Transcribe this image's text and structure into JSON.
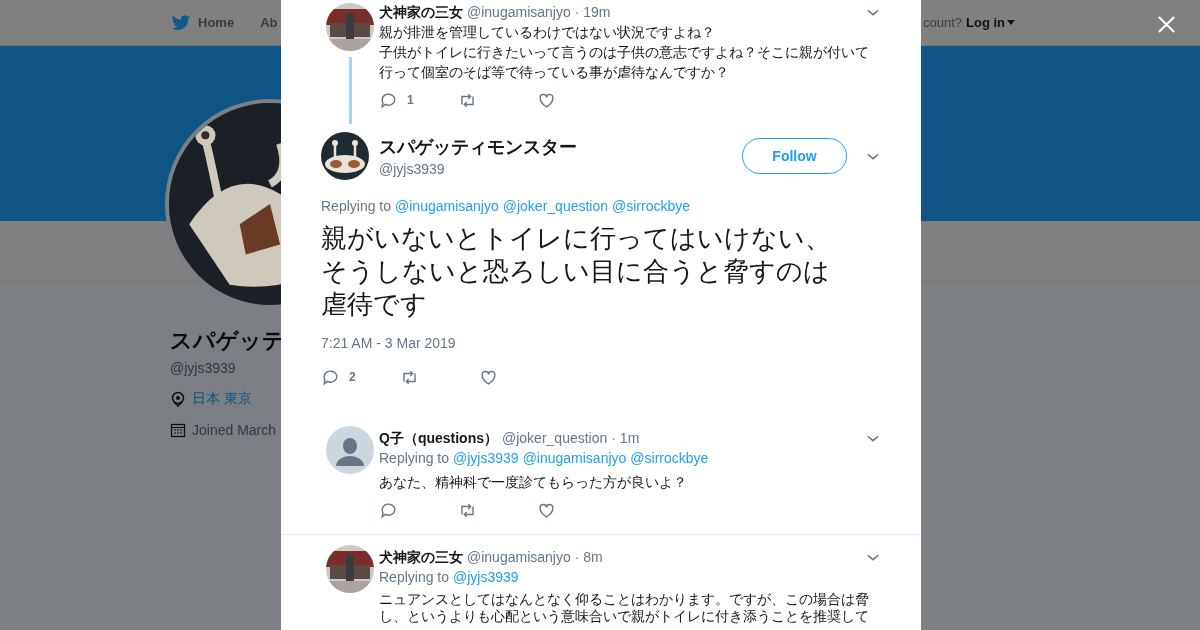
{
  "nav": {
    "items": [
      {
        "label": "Home"
      },
      {
        "label": "Ab"
      }
    ],
    "account_prompt": "count?",
    "login": "Log in"
  },
  "profile": {
    "name": "スパゲッテ",
    "handle": "@jyjs3939",
    "location": "日本 東京",
    "joined": "Joined March"
  },
  "parent_tweet": {
    "author": "犬神家の三女",
    "handle": "@inugamisanjyo",
    "time": "· 19m",
    "lines": [
      "親が排泄を管理しているわけではない状況ですよね？",
      "子供がトイレに行きたいって言うのは子供の意志ですよね？そこに親が付いて",
      "行って個室のそば等で待っている事が虐待なんですか？"
    ],
    "reply_count": "1"
  },
  "main_tweet": {
    "author": "スパゲッティモンスター",
    "handle": "@jyjs3939",
    "follow": "Follow",
    "replying_label": "Replying to",
    "replying_to": [
      "@inugamisanjyo",
      "@joker_question",
      "@sirrockbye"
    ],
    "lines": [
      "親がいないとトイレに行ってはいけない、",
      "そうしないと恐ろしい目に合うと脅すのは",
      "虐待です"
    ],
    "timestamp": "7:21 AM - 3 Mar 2019",
    "reply_count": "2"
  },
  "replies": [
    {
      "author": "Q子（questions）",
      "handle": "@joker_question",
      "time": "· 1m",
      "replying_label": "Replying to",
      "replying_to": [
        "@jyjs3939",
        "@inugamisanjyo",
        "@sirrockbye"
      ],
      "lines": [
        "あなた、精神科で一度診てもらった方が良いよ？"
      ]
    },
    {
      "author": "犬神家の三女",
      "handle": "@inugamisanjyo",
      "time": "· 8m",
      "replying_label": "Replying to",
      "replying_to": [
        "@jyjs3939"
      ],
      "lines": [
        "ニュアンスとしてはなんとなく仰ることはわかります。ですが、この場合は脅",
        "し、というよりも心配という意味合いで親がトイレに付き添うことを推奨して"
      ]
    }
  ]
}
